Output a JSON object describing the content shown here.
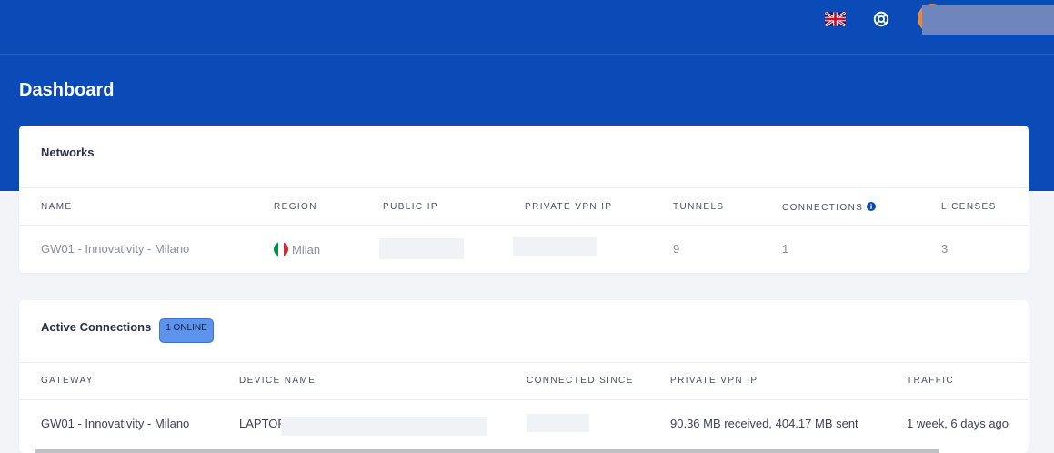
{
  "topbar": {
    "language_icon": "uk-flag-icon",
    "help_icon": "lifebuoy-icon"
  },
  "page": {
    "title": "Dashboard"
  },
  "networks": {
    "title": "Networks",
    "columns": [
      "NAME",
      "REGION",
      "PUBLIC IP",
      "PRIVATE VPN IP",
      "TUNNELS",
      "CONNECTIONS",
      "LICENSES"
    ],
    "rows": [
      {
        "name": "GW01 - Innovativity - Milano",
        "region": "Milan",
        "region_flag": "italy-flag-icon",
        "tunnels": "9",
        "connections": "1",
        "licenses": "3"
      }
    ]
  },
  "active_connections": {
    "title": "Active Connections",
    "badge": "1 ONLINE",
    "columns": [
      "GATEWAY",
      "DEVICE NAME",
      "CONNECTED SINCE",
      "PRIVATE VPN IP",
      "TRAFFIC"
    ],
    "rows": [
      {
        "gateway": "GW01 - Innovativity - Milano",
        "device_prefix": "LAPTOP",
        "traffic": "90.36 MB received, 404.17 MB sent",
        "duration": "1 week, 6 days ago"
      }
    ]
  },
  "colors": {
    "header_blue": "#0b4bb7",
    "badge_blue": "#5d93ec",
    "avatar_orange": "#e78a3f"
  }
}
